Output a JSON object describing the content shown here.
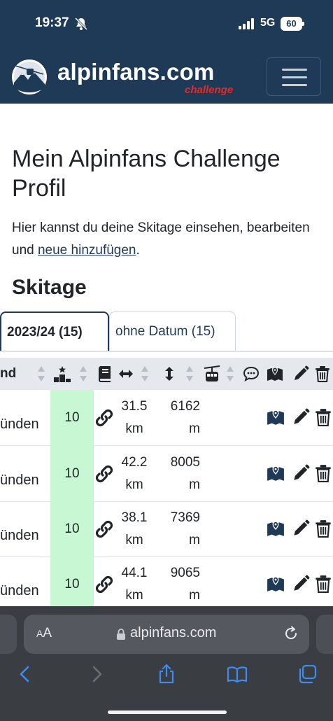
{
  "status_bar": {
    "time": "19:37",
    "network": "5G",
    "battery": "60"
  },
  "navbar": {
    "brand": "alpinfans.com",
    "brand_sub": "challenge"
  },
  "page": {
    "title": "Mein Alpinfans Challenge Profil",
    "intro_text": "Hier kannst du deine Skitage einsehen, bearbeiten und ",
    "intro_link": "neue hinzufügen",
    "intro_end": ".",
    "section_title": "Skitage"
  },
  "tabs": [
    {
      "label": "2023/24 (15)",
      "active": true
    },
    {
      "label": "ohne Datum (15)",
      "active": false
    }
  ],
  "table": {
    "header_first": "nd",
    "rows": [
      {
        "region": "ünden",
        "score": "10",
        "dist_value": "31.5",
        "dist_unit": "km",
        "elev_value": "6162",
        "elev_unit": "m"
      },
      {
        "region": "ünden",
        "score": "10",
        "dist_value": "42.2",
        "dist_unit": "km",
        "elev_value": "8005",
        "elev_unit": "m"
      },
      {
        "region": "ünden",
        "score": "10",
        "dist_value": "38.1",
        "dist_unit": "km",
        "elev_value": "7369",
        "elev_unit": "m"
      },
      {
        "region": "ünden",
        "score": "10",
        "dist_value": "44.1",
        "dist_unit": "km",
        "elev_value": "9065",
        "elev_unit": "m"
      }
    ]
  },
  "browser": {
    "aa_small": "A",
    "aa_large": "A",
    "url": "alpinfans.com"
  },
  "colors": {
    "navbar": "#1f3a57",
    "score_bg": "#c7f7d3",
    "brand_sub": "#e32b2b",
    "icon": "#1f3a57"
  },
  "icons": [
    "bell-slash-icon",
    "signal-icon",
    "podium-icon",
    "book-icon",
    "arrows-horizontal-icon",
    "arrows-vertical-icon",
    "cable-car-icon",
    "comment-icon",
    "map-icon",
    "pencil-icon",
    "trash-icon",
    "link-icon",
    "lock-icon",
    "reload-icon",
    "back-icon",
    "forward-icon",
    "share-icon",
    "bookmarks-icon",
    "tabs-icon"
  ]
}
